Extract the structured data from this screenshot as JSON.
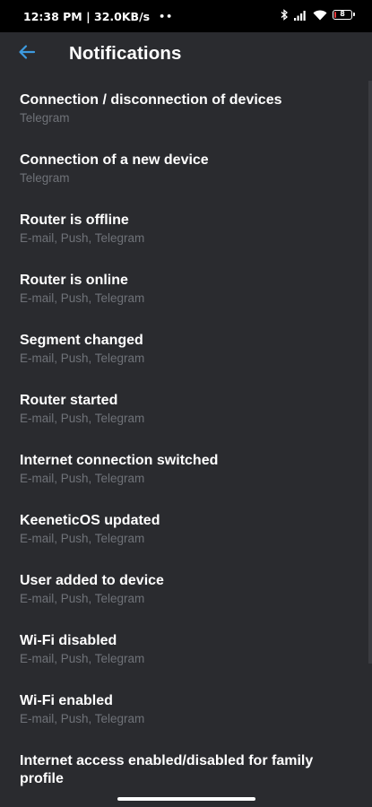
{
  "status_bar": {
    "time_speed": "12:38 PM | 32.0KB/s",
    "dots": "••",
    "battery_text": "8",
    "battery_level": 0.08,
    "colors": {
      "battery_low": "#e5393a"
    }
  },
  "app_bar": {
    "title": "Notifications",
    "back_icon": "arrow-left-icon",
    "accent_color": "#3d9be0"
  },
  "notifications": [
    {
      "title": "Connection / disconnection of devices",
      "channels": "Telegram"
    },
    {
      "title": "Connection of a new device",
      "channels": "Telegram"
    },
    {
      "title": "Router is offline",
      "channels": "E-mail, Push, Telegram"
    },
    {
      "title": "Router is online",
      "channels": "E-mail, Push, Telegram"
    },
    {
      "title": "Segment changed",
      "channels": "E-mail, Push, Telegram"
    },
    {
      "title": "Router started",
      "channels": "E-mail, Push, Telegram"
    },
    {
      "title": "Internet connection switched",
      "channels": "E-mail, Push, Telegram"
    },
    {
      "title": "KeeneticOS updated",
      "channels": "E-mail, Push, Telegram"
    },
    {
      "title": "User added to device",
      "channels": "E-mail, Push, Telegram"
    },
    {
      "title": "Wi-Fi disabled",
      "channels": "E-mail, Push, Telegram"
    },
    {
      "title": "Wi-Fi enabled",
      "channels": "E-mail, Push, Telegram"
    },
    {
      "title": "Internet access enabled/disabled for family profile",
      "channels": ""
    }
  ]
}
